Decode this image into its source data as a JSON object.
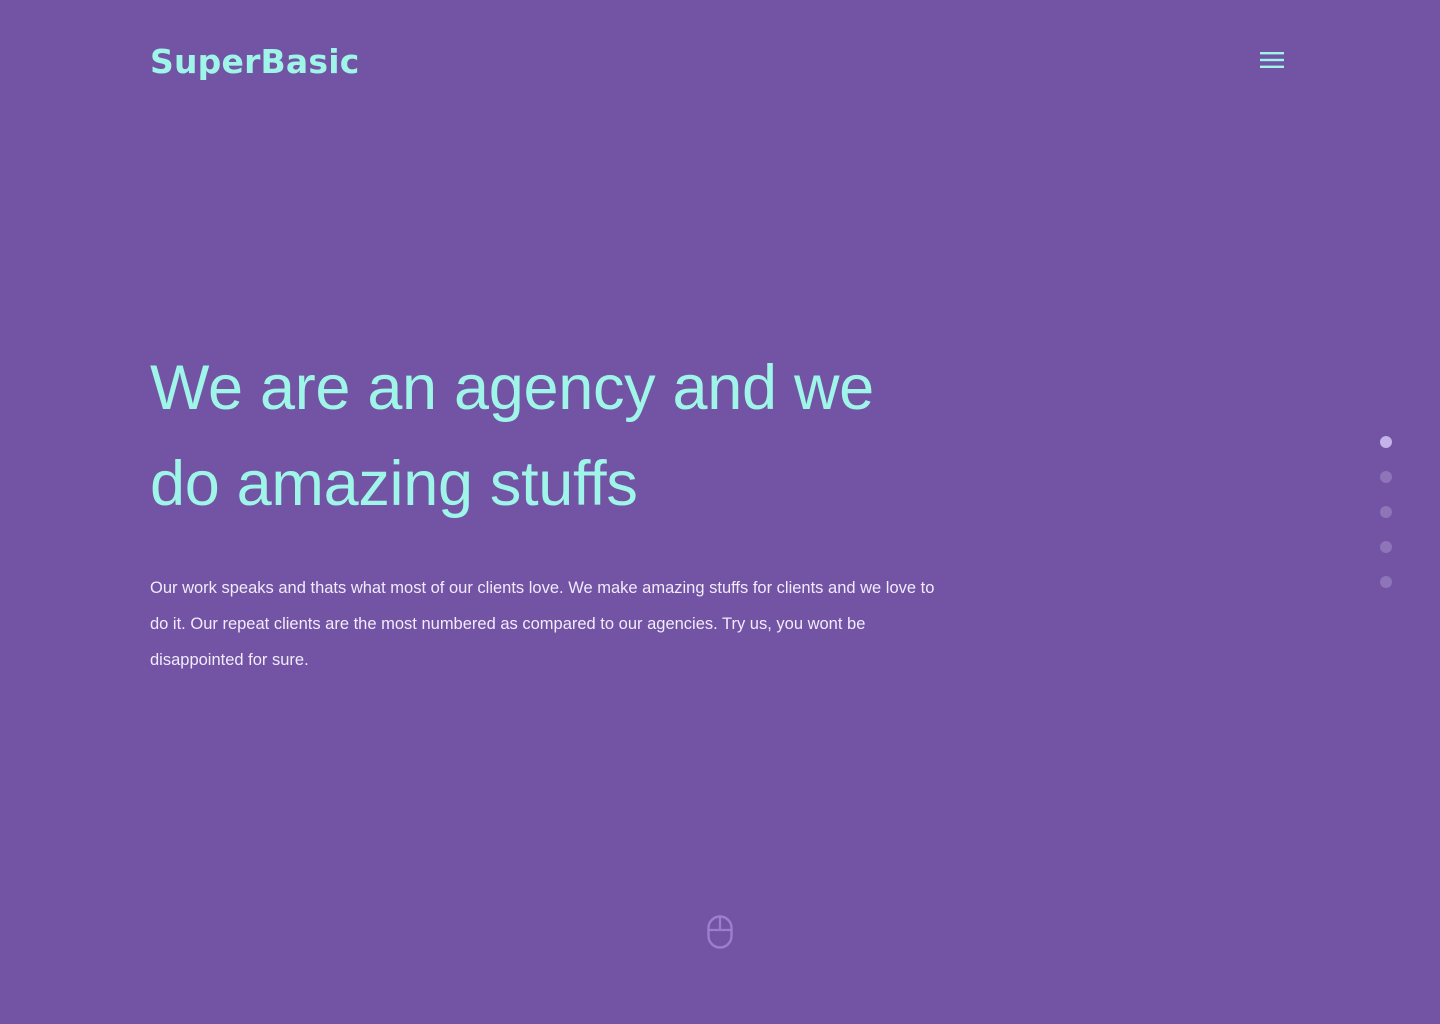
{
  "brand": {
    "name": "SuperBasic"
  },
  "header": {
    "menu_icon": "hamburger-menu-icon"
  },
  "hero": {
    "title": "We are an agency and we do amazing stuffs",
    "text": "Our work speaks and thats what most of our clients love. We make amazing stuffs for clients and we love to do it. Our repeat clients are the most numbered as compared to our agencies. Try us, you wont be disappointed for sure."
  },
  "pagination": {
    "count": 5,
    "active_index": 0
  },
  "scroll_indicator": {
    "icon": "mouse-icon"
  },
  "colors": {
    "background": "#7353a4",
    "accent": "#9ff5e8",
    "body_text": "#f1ebfb",
    "dot_active": "#c4b3e6",
    "dot_inactive": "#8e75b9"
  }
}
